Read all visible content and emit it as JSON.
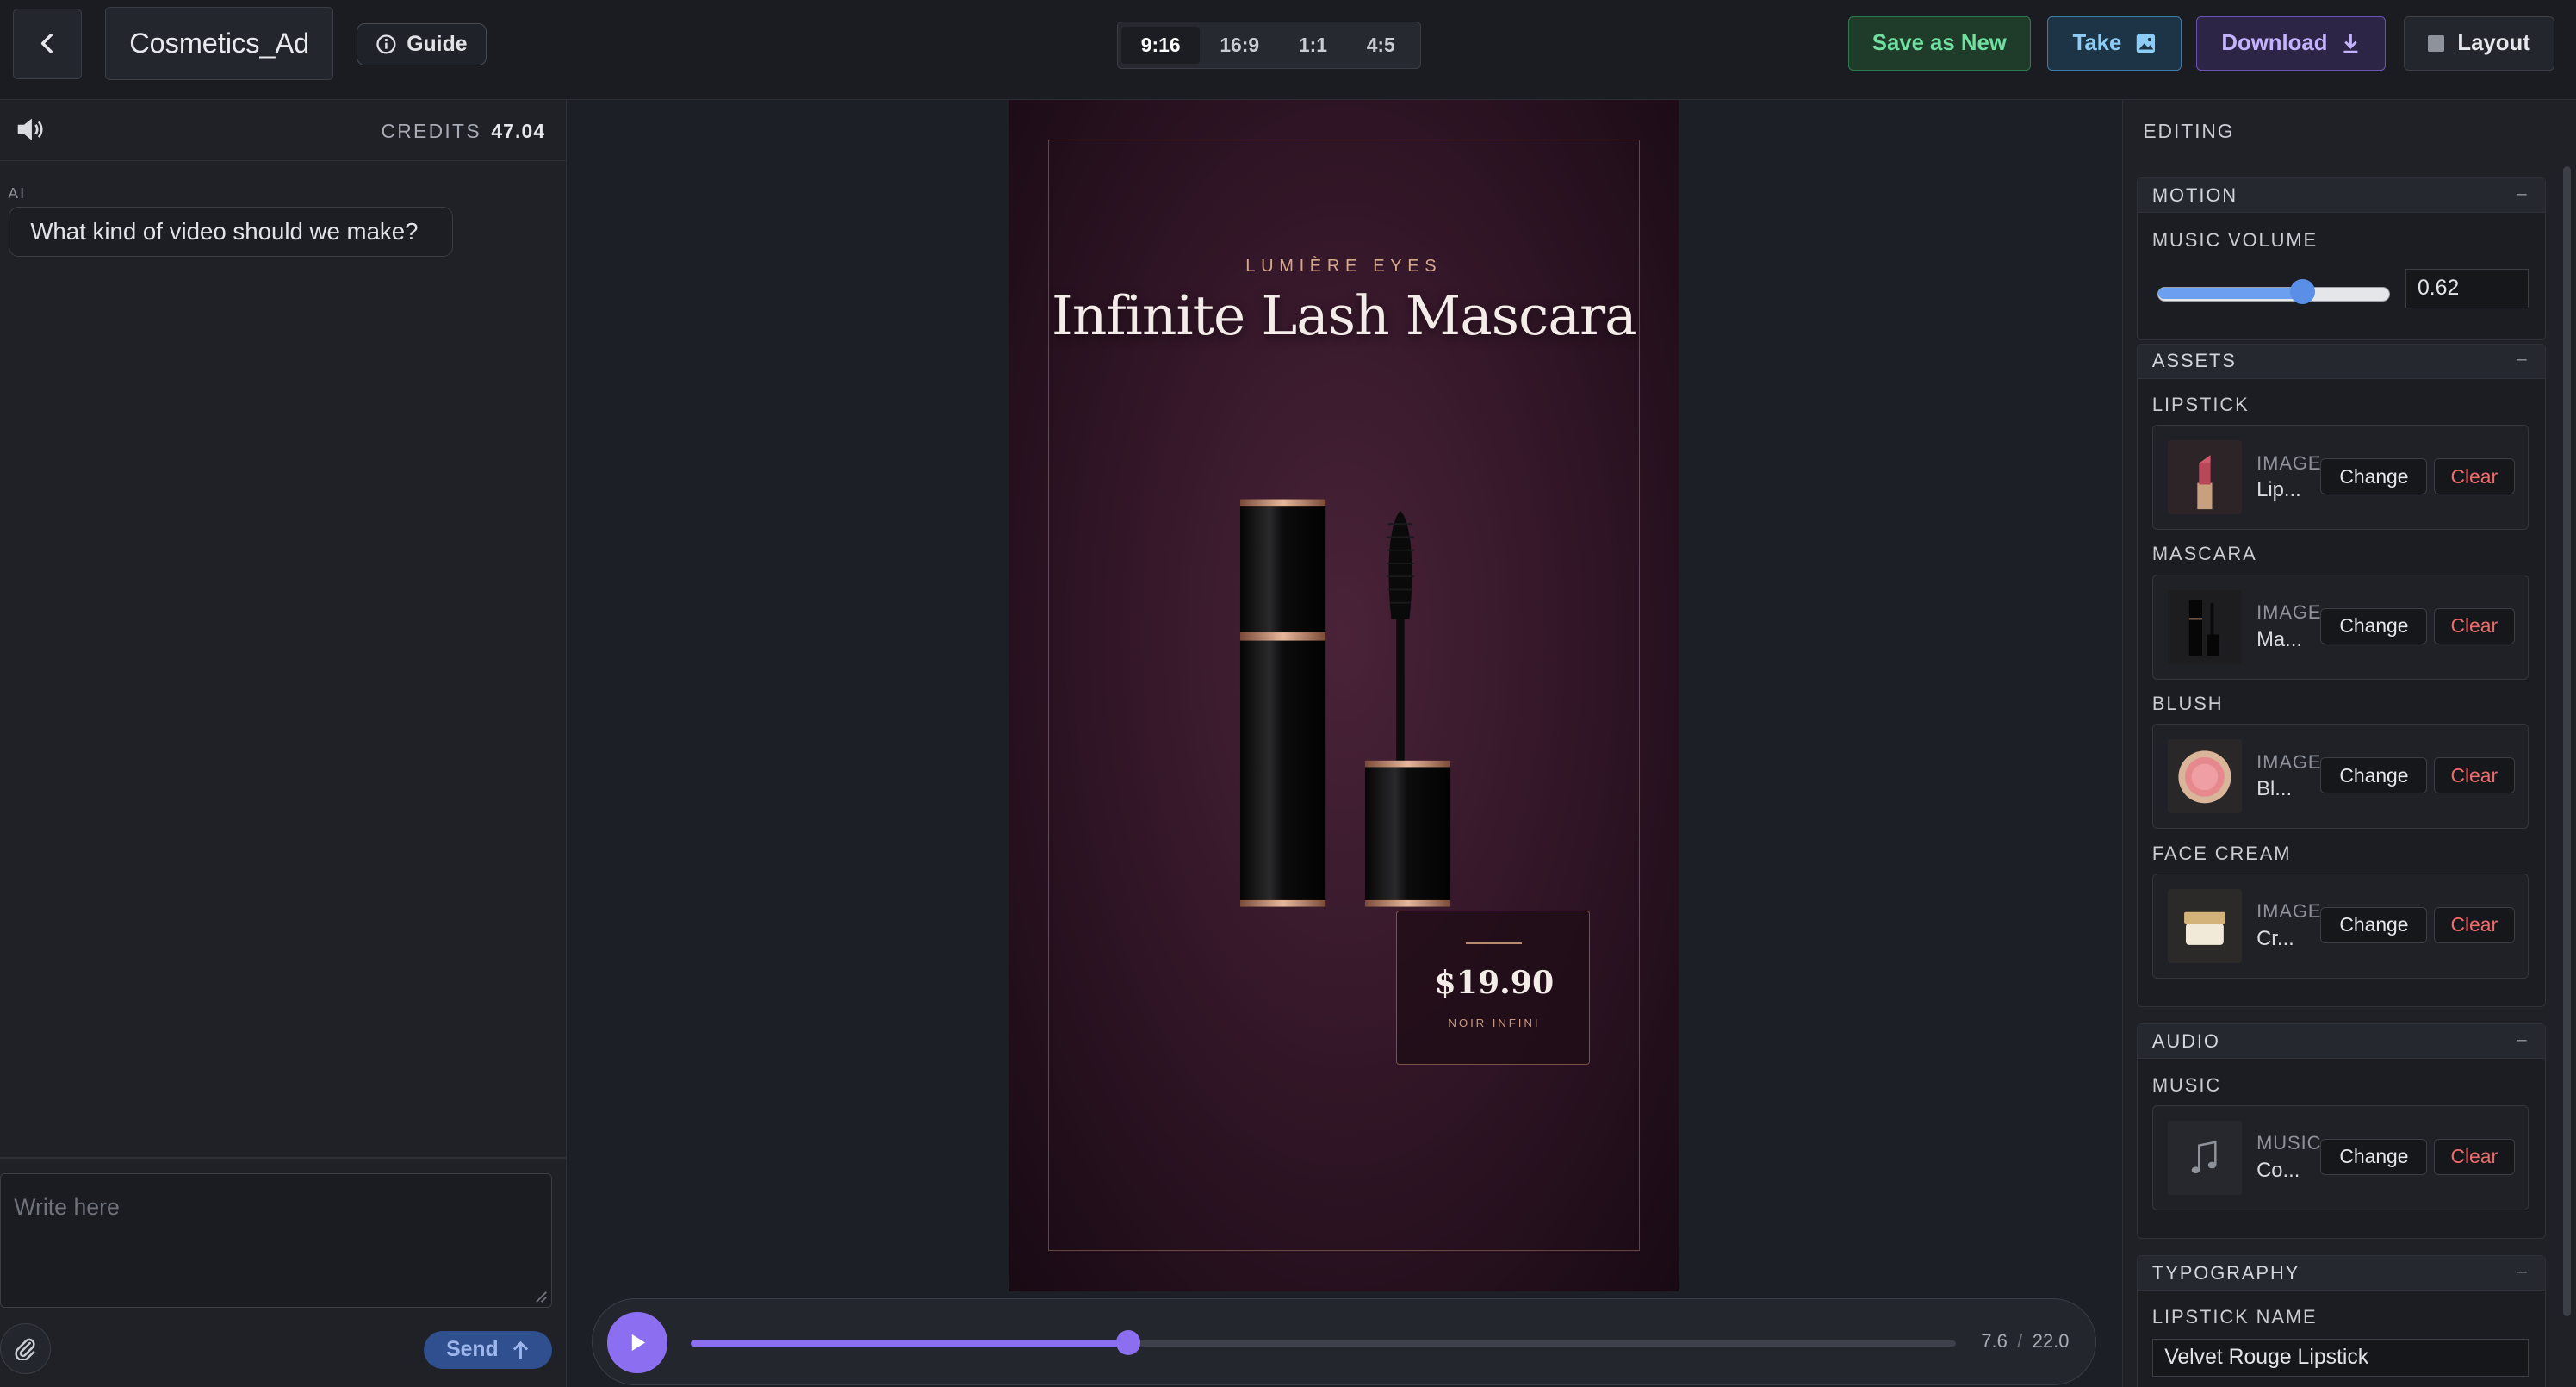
{
  "header": {
    "project_title": "Cosmetics_Ad",
    "guide_label": "Guide",
    "aspect_ratios": [
      "9:16",
      "16:9",
      "1:1",
      "4:5"
    ],
    "active_ratio": "9:16",
    "save_label": "Save as New",
    "take_label": "Take",
    "download_label": "Download",
    "layout_label": "Layout"
  },
  "chat": {
    "credits_label": "CREDITS",
    "credits_value": "47.04",
    "ai_label": "AI",
    "ai_message": "What kind of video should we make?",
    "input_placeholder": "Write here",
    "send_label": "Send"
  },
  "preview": {
    "brand": "LUMIÈRE EYES",
    "product_title": "Infinite Lash Mascara",
    "price": "$19.90",
    "price_subtitle": "NOIR INFINI"
  },
  "player": {
    "current_time": "7.6",
    "separator": "/",
    "duration": "22.0",
    "progress_fraction": 0.345
  },
  "editor": {
    "title": "EDITING",
    "motion": {
      "heading": "MOTION",
      "collapse_symbol": "–",
      "music_volume_label": "MUSIC VOLUME",
      "music_volume_value": "0.62",
      "music_volume_fraction": 0.62
    },
    "assets": {
      "heading": "ASSETS",
      "collapse_symbol": "–",
      "items": [
        {
          "label": "LIPSTICK",
          "type": "IMAGE",
          "name": "Lip...",
          "change": "Change",
          "clear": "Clear",
          "icon": "lipstick-thumbnail"
        },
        {
          "label": "MASCARA",
          "type": "IMAGE",
          "name": "Ma...",
          "change": "Change",
          "clear": "Clear",
          "icon": "mascara-thumbnail"
        },
        {
          "label": "BLUSH",
          "type": "IMAGE",
          "name": "Bl...",
          "change": "Change",
          "clear": "Clear",
          "icon": "blush-thumbnail"
        },
        {
          "label": "FACE CREAM",
          "type": "IMAGE",
          "name": "Cr...",
          "change": "Change",
          "clear": "Clear",
          "icon": "face-cream-thumbnail"
        }
      ]
    },
    "audio": {
      "heading": "AUDIO",
      "collapse_symbol": "–",
      "music_label": "MUSIC",
      "music_type": "MUSIC",
      "music_name": "Co...",
      "change": "Change",
      "clear": "Clear"
    },
    "typography": {
      "heading": "TYPOGRAPHY",
      "collapse_symbol": "–",
      "lipstick_name_label": "LIPSTICK NAME",
      "lipstick_name_value": "Velvet Rouge Lipstick"
    }
  },
  "colors": {
    "accent_purple": "#8b6ff0",
    "save_green": "#6fe0a0",
    "take_blue": "#8dccf5",
    "download_violet": "#c3b3ff",
    "clear_red": "#f06b6b",
    "slider_blue": "#5b8ee6"
  }
}
